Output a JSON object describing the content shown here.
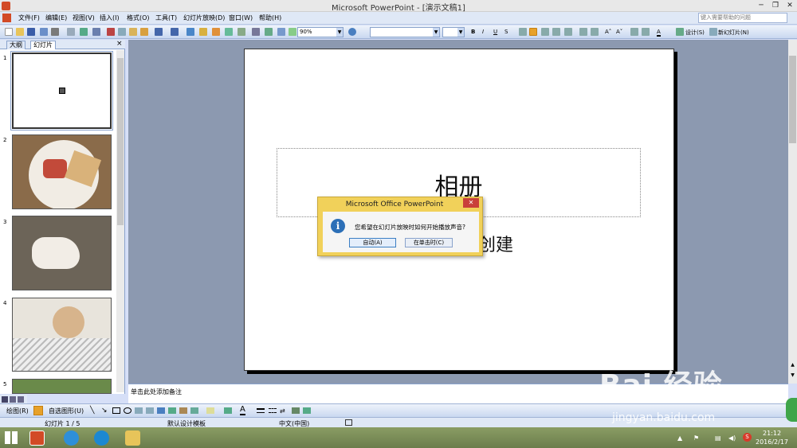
{
  "window": {
    "title": "Microsoft PowerPoint - [演示文稿1]",
    "minimize": "─",
    "restore": "❐",
    "close": "✕"
  },
  "menu": {
    "items": [
      "文件(F)",
      "编辑(E)",
      "视图(V)",
      "插入(I)",
      "格式(O)",
      "工具(T)",
      "幻灯片放映(D)",
      "窗口(W)",
      "帮助(H)"
    ],
    "help_placeholder": "键入需要帮助的问题"
  },
  "toolbar": {
    "zoom": "90%",
    "design_label": "设计(S)",
    "new_slide_label": "新幻灯片(N)"
  },
  "left_pane": {
    "tabs": [
      "大纲",
      "幻灯片"
    ],
    "close": "×",
    "slide_numbers": [
      "1",
      "2",
      "3",
      "4",
      "5"
    ]
  },
  "slide": {
    "title": "相册",
    "subtitle": "创建"
  },
  "notes": {
    "placeholder": "单击此处添加备注"
  },
  "drawing_toolbar": {
    "draw_label": "绘图(R)",
    "autoshapes_label": "自选图形(U)"
  },
  "status": {
    "slide_count": "幻灯片 1 / 5",
    "template": "默认设计模板",
    "language": "中文(中国)"
  },
  "dialog": {
    "title": "Microsoft Office PowerPoint",
    "message": "您希望在幻灯片放映时如何开始播放声音?",
    "btn_auto": "自动(A)",
    "btn_click": "在单击时(C)",
    "close": "✕",
    "info_icon": "i"
  },
  "taskbar": {
    "time": "21:12",
    "date": "2016/2/17"
  },
  "watermark": {
    "brand": "Bai 经验",
    "url": "jingyan.baidu.com"
  },
  "colors": {
    "dialog_frame": "#f1d15a",
    "close_red": "#c9403a",
    "accent_blue": "#2c6fb7"
  }
}
